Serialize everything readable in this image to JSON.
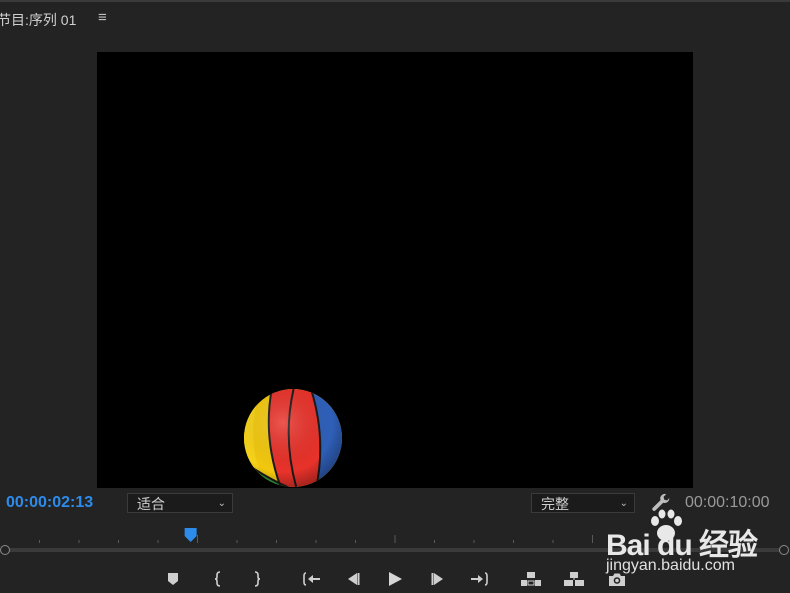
{
  "panel": {
    "title": "节目:序列 01",
    "menu_icon": "hamburger-icon",
    "menu_glyph": "≡"
  },
  "viewer": {
    "background": "#000000",
    "content": "basketball-ball"
  },
  "timecode": {
    "current": "00:00:02:13",
    "duration": "00:00:10:00",
    "current_color": "#2d8ceb"
  },
  "zoom_dropdown": {
    "selected": "适合",
    "icon": "chevron-down-icon"
  },
  "quality_dropdown": {
    "selected": "完整",
    "icon": "chevron-down-icon"
  },
  "settings_icon": "wrench-icon",
  "playhead_position": 0.2413,
  "controls": [
    {
      "name": "add-marker-button",
      "icon": "marker-icon"
    },
    {
      "name": "mark-in-button",
      "icon": "mark-in-icon"
    },
    {
      "name": "mark-out-button",
      "icon": "mark-out-icon"
    },
    {
      "name": "go-to-in-button",
      "icon": "go-to-in-icon"
    },
    {
      "name": "step-back-button",
      "icon": "step-back-icon"
    },
    {
      "name": "play-button",
      "icon": "play-icon"
    },
    {
      "name": "step-forward-button",
      "icon": "step-forward-icon"
    },
    {
      "name": "go-to-out-button",
      "icon": "go-to-out-icon"
    },
    {
      "name": "lift-button",
      "icon": "lift-icon"
    },
    {
      "name": "extract-button",
      "icon": "extract-icon"
    },
    {
      "name": "export-frame-button",
      "icon": "camera-icon"
    }
  ],
  "watermark": {
    "logo_text": "Bai du 经验",
    "url": "jingyan.baidu.com"
  }
}
